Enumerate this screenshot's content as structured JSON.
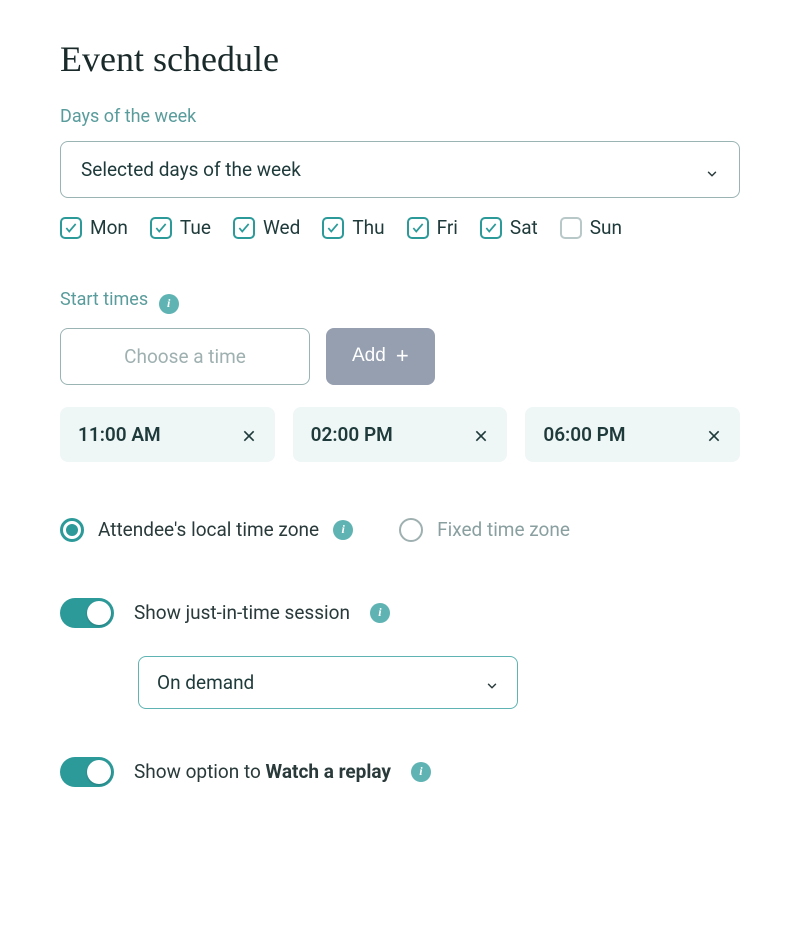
{
  "heading": "Event schedule",
  "days_section": {
    "label": "Days of the week",
    "select_value": "Selected days of the week",
    "days": [
      {
        "label": "Mon",
        "checked": true
      },
      {
        "label": "Tue",
        "checked": true
      },
      {
        "label": "Wed",
        "checked": true
      },
      {
        "label": "Thu",
        "checked": true
      },
      {
        "label": "Fri",
        "checked": true
      },
      {
        "label": "Sat",
        "checked": true
      },
      {
        "label": "Sun",
        "checked": false
      }
    ]
  },
  "start_times": {
    "label": "Start times",
    "placeholder": "Choose a time",
    "add_label": "Add",
    "times": [
      "11:00 AM",
      "02:00 PM",
      "06:00 PM"
    ]
  },
  "timezone": {
    "local_label": "Attendee's local time zone",
    "fixed_label": "Fixed time zone",
    "selected": "local"
  },
  "jit": {
    "label": "Show just-in-time session",
    "enabled": true,
    "select_value": "On demand"
  },
  "replay": {
    "label_prefix": "Show option to ",
    "label_bold": "Watch a replay",
    "enabled": true
  }
}
